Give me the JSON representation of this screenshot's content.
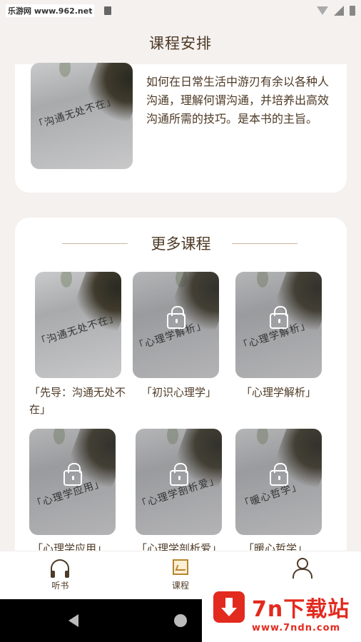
{
  "status_bar": {
    "watermark": "乐游网 www.962.net"
  },
  "header": {
    "title": "课程安排"
  },
  "current_course": {
    "thumb_title": "「沟通无处不在」",
    "description": "如何在日常生活中游刃有余以各种人沟通，理解何谓沟通，并培养出高效沟通所需的技巧。是本书的主旨。"
  },
  "more_courses": {
    "title": "更多课程",
    "items": [
      {
        "label": "「先导：沟通无处不在」",
        "thumb_title": "「沟通无处不在」",
        "locked": false
      },
      {
        "label": "「初识心理学」",
        "thumb_title": "「心理学解析」",
        "locked": true
      },
      {
        "label": "「心理学解析」",
        "thumb_title": "「心理学解析」",
        "locked": true
      },
      {
        "label": "「心理学应用」",
        "thumb_title": "「心理学应用」",
        "locked": true
      },
      {
        "label": "「心理学剖析爱」",
        "thumb_title": "「心理学剖析爱」",
        "locked": true
      },
      {
        "label": "「暖心哲学」",
        "thumb_title": "「暖心哲学」",
        "locked": true
      }
    ]
  },
  "bottom_nav": [
    {
      "label": "听书",
      "icon": "headphones-icon",
      "active": false
    },
    {
      "label": "课程",
      "icon": "chart-icon",
      "active": true
    },
    {
      "label": "我的",
      "icon": "user-icon",
      "active": false
    }
  ],
  "ad": {
    "title": "7n下载站",
    "url": "www.7ndn.com"
  },
  "colors": {
    "accent": "#b8862f",
    "text": "#4e3a26",
    "background": "#f5f1ef"
  }
}
